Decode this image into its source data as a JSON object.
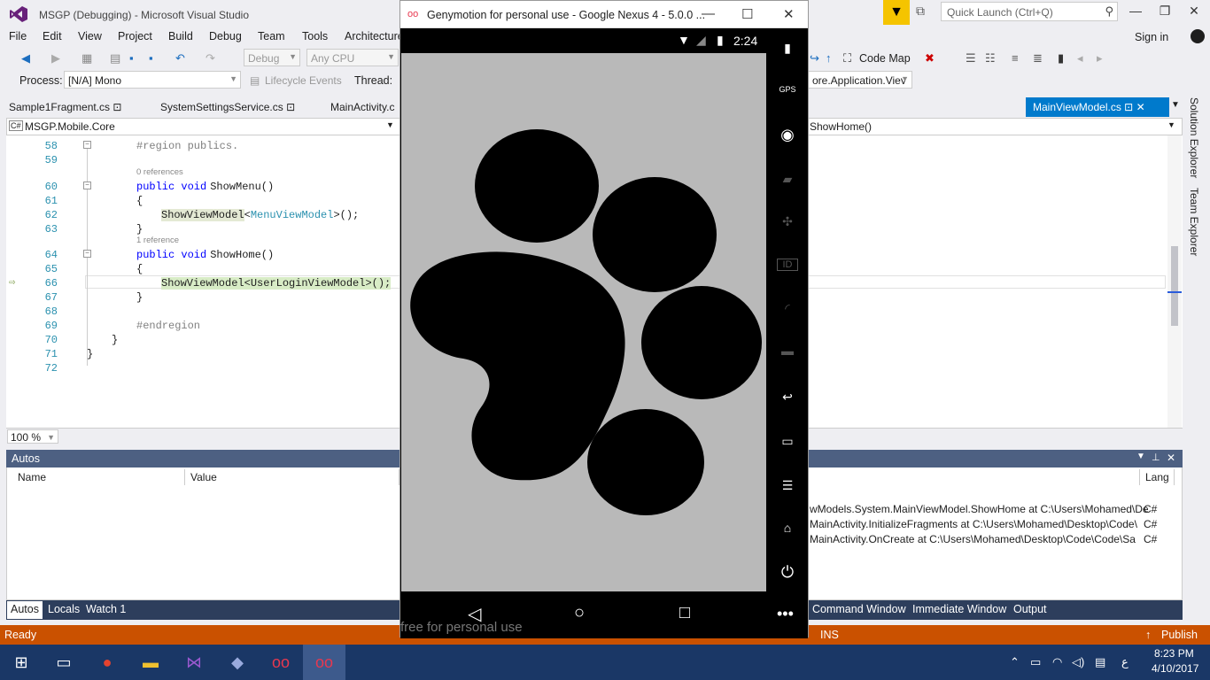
{
  "vs": {
    "window_title": "MSGP (Debugging) - Microsoft Visual Studio",
    "quick_launch_placeholder": "Quick Launch (Ctrl+Q)",
    "menu": [
      "File",
      "Edit",
      "View",
      "Project",
      "Build",
      "Debug",
      "Team",
      "Tools",
      "Architecture"
    ],
    "sign_in": "Sign in",
    "toolbar": {
      "config": "Debug",
      "platform": "Any CPU",
      "code_map": "Code Map"
    },
    "toolbar2": {
      "process_label": "Process:",
      "process_value": "[N/A] Mono",
      "lifecycle": "Lifecycle Events",
      "thread_label": "Thread:",
      "right_combo": "ore.Application.Viev"
    },
    "tabs": [
      "Sample1Fragment.cs",
      "SystemSettingsService.cs",
      "MainActivity.c"
    ],
    "active_tab": "MainViewModel.cs",
    "nav_left": "MSGP.Mobile.Core",
    "nav_right": "ShowHome()",
    "code": {
      "lines": [
        "58",
        "59",
        "60",
        "61",
        "62",
        "63",
        "64",
        "65",
        "66",
        "67",
        "68",
        "69",
        "70",
        "71",
        "72"
      ],
      "region": "#region publics.",
      "ref0": "0 references",
      "showmenu_sig_kw": "public void",
      "showmenu_name": " ShowMenu()",
      "brace_open": "{",
      "brace_close": "}",
      "showmenu_body_a": "ShowViewModel",
      "showmenu_body_b": "<",
      "showmenu_body_type": "MenuViewModel",
      "showmenu_body_c": ">();",
      "ref1": "1 reference",
      "showhome_name": " ShowHome()",
      "showhome_body": "ShowViewModel<UserLoginViewModel>();",
      "endregion": "#endregion",
      "ns_close": "}",
      "file_close": "}"
    },
    "zoom": "100 %",
    "autos": {
      "title": "Autos",
      "col_name": "Name",
      "col_value": "Value",
      "col_lang": "Lang",
      "stack": [
        {
          "text": "wModels.System.MainViewModel.ShowHome at C:\\Users\\Mohamed\\De",
          "lang": "C#"
        },
        {
          "text": "MainActivity.InitializeFragments at C:\\Users\\Mohamed\\Desktop\\Code\\",
          "lang": "C#"
        },
        {
          "text": "MainActivity.OnCreate at C:\\Users\\Mohamed\\Desktop\\Code\\Code\\Sa",
          "lang": "C#"
        }
      ],
      "bottom_tabs_left": [
        "Autos",
        "Locals",
        "Watch 1"
      ],
      "bottom_tabs_right": [
        "Command Window",
        "Immediate Window",
        "Output"
      ]
    },
    "status": {
      "left": "Ready",
      "ins": "INS",
      "publish": "Publish"
    },
    "side": {
      "solution_explorer": "Solution Explorer",
      "team_explorer": "Team Explorer"
    }
  },
  "geny": {
    "title": "Genymotion for personal use - Google Nexus 4 - 5.0.0 ...",
    "clock": "2:24",
    "watermark": "free for personal use",
    "side_icons": [
      "battery-icon",
      "gps-icon",
      "webcam-icon",
      "clapper-icon",
      "move-icon",
      "id-icon",
      "rss-icon",
      "chat-icon",
      "back-icon",
      "recent-icon",
      "menu-icon",
      "home-icon",
      "power-icon",
      "more-icon"
    ]
  },
  "taskbar": {
    "time": "8:23 PM",
    "date": "4/10/2017",
    "lang": "ع"
  }
}
